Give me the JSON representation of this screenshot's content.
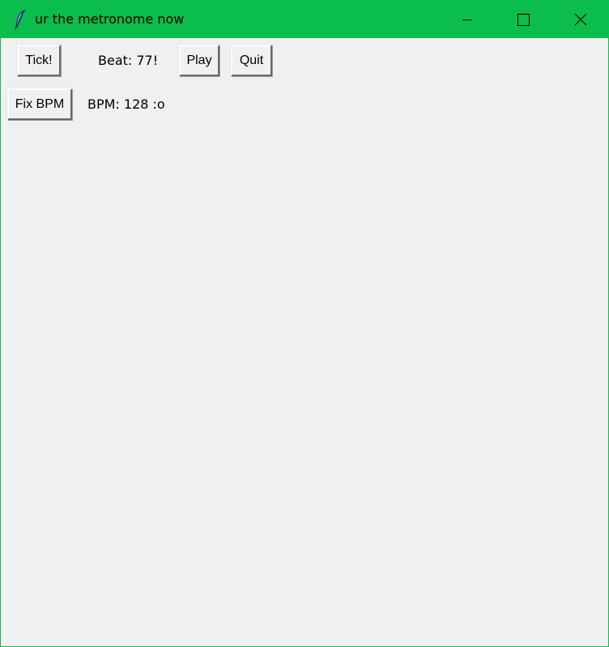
{
  "window": {
    "title": "ur the metronome now",
    "title_bar_color": "#0bbd4a",
    "icon": "feather-icon",
    "controls": {
      "minimize_icon": "minimize-icon",
      "maximize_icon": "maximize-icon",
      "close_icon": "close-icon"
    }
  },
  "row1": {
    "tick_label": "Tick!",
    "beat_text": "Beat: 77!",
    "play_label": "Play",
    "quit_label": "Quit"
  },
  "row2": {
    "fix_bpm_label": "Fix BPM",
    "bpm_text": "BPM: 128 :o"
  }
}
